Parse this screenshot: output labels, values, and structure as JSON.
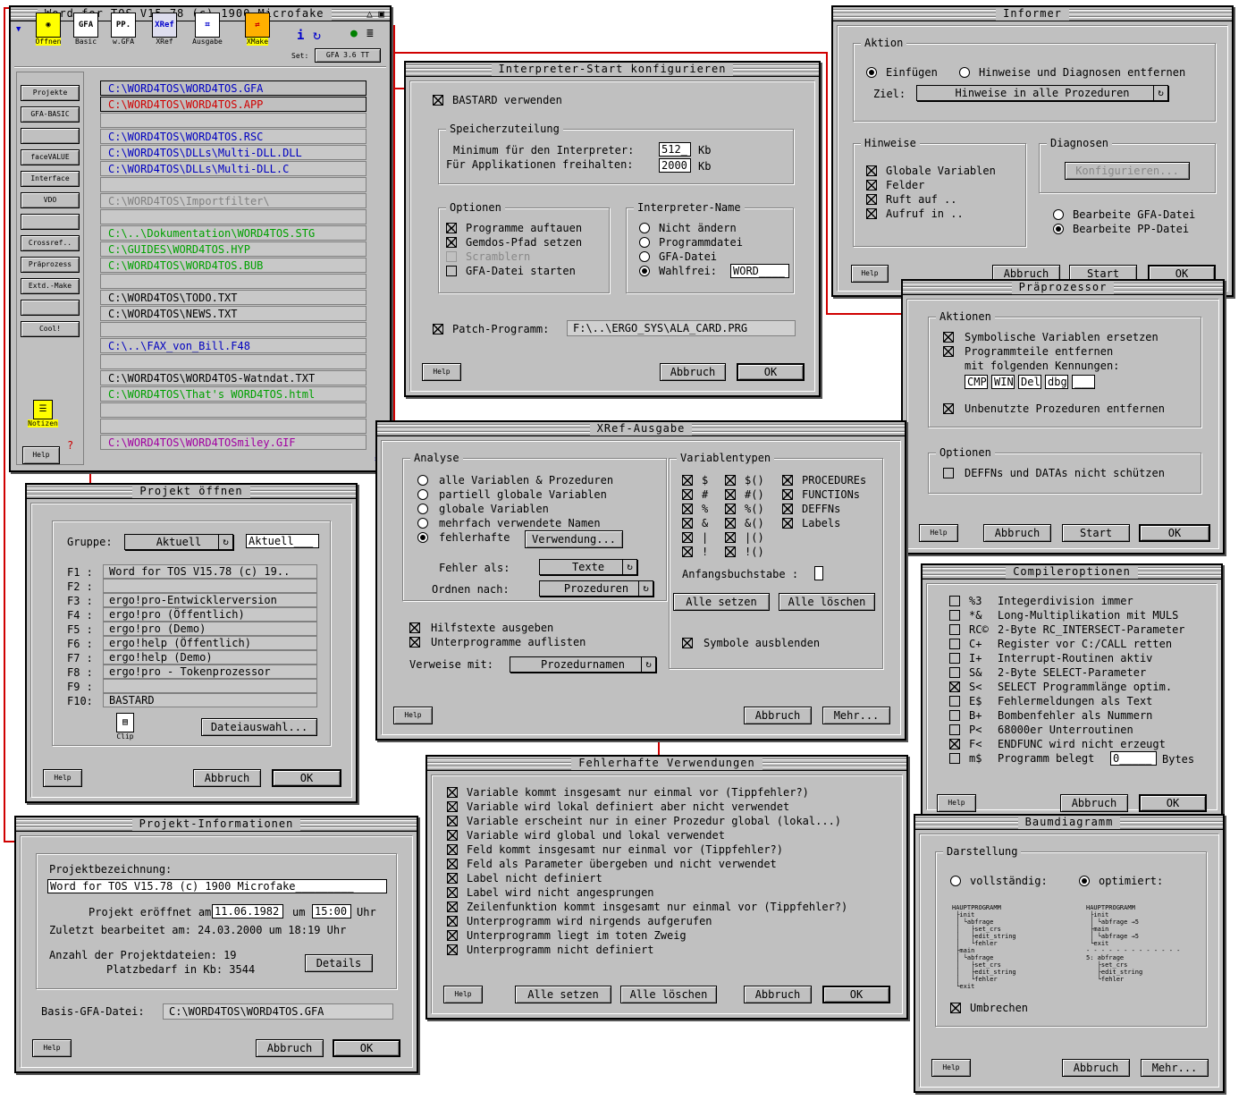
{
  "main": {
    "title": "Word for TOS V15.78 (c) 1900 Microfake",
    "tools": [
      "Öffnen",
      "Basic",
      "w.GFA",
      "XRef",
      "Ausgabe",
      "XMake"
    ],
    "tool_icons": [
      "GFA",
      "PP.",
      "XRef"
    ],
    "set_label": "Set:",
    "set_value": "GFA 3.6 TT",
    "side": [
      "Projekte",
      "GFA-BASIC",
      "",
      "faceVALUE",
      "Interface",
      "VDO",
      "",
      "Crossref..",
      "Präprozess",
      "Extd.-Make",
      "",
      "Cool!"
    ],
    "notizen": "Notizen",
    "help": "Help",
    "files": [
      {
        "t": "C:\\WORD4TOS\\WORD4TOS.GFA",
        "c": "#0000c0"
      },
      {
        "t": "C:\\WORD4TOS\\WORD4TOS.APP",
        "c": "#d00000"
      },
      {
        "t": "",
        "c": "#000"
      },
      {
        "t": "C:\\WORD4TOS\\WORD4TOS.RSC",
        "c": "#0000c0"
      },
      {
        "t": "C:\\WORD4TOS\\DLLs\\Multi-DLL.DLL",
        "c": "#0000c0"
      },
      {
        "t": "C:\\WORD4TOS\\DLLs\\Multi-DLL.C",
        "c": "#0000c0"
      },
      {
        "t": "",
        "c": "#000"
      },
      {
        "t": "C:\\WORD4TOS\\Importfilter\\",
        "c": "#808080"
      },
      {
        "t": "",
        "c": "#000"
      },
      {
        "t": "C:\\..\\Dokumentation\\WORD4TOS.STG",
        "c": "#00a000"
      },
      {
        "t": "C:\\GUIDES\\WORD4TOS.HYP",
        "c": "#00a000"
      },
      {
        "t": "C:\\WORD4TOS\\WORD4TOS.BUB",
        "c": "#00a000"
      },
      {
        "t": "",
        "c": "#000"
      },
      {
        "t": "C:\\WORD4TOS\\TODO.TXT",
        "c": "#000"
      },
      {
        "t": "C:\\WORD4TOS\\NEWS.TXT",
        "c": "#000"
      },
      {
        "t": "",
        "c": "#000"
      },
      {
        "t": "C:\\..\\FAX_von_Bill.F48",
        "c": "#0000c0"
      },
      {
        "t": "",
        "c": "#000"
      },
      {
        "t": "C:\\WORD4TOS\\WORD4TOS-Watndat.TXT",
        "c": "#000"
      },
      {
        "t": "C:\\WORD4TOS\\That's WORD4TOS.html",
        "c": "#00a000"
      },
      {
        "t": "",
        "c": "#000"
      },
      {
        "t": "",
        "c": "#000"
      },
      {
        "t": "C:\\WORD4TOS\\WORD4TOSmiley.GIF",
        "c": "#a000a0"
      }
    ]
  },
  "interp": {
    "title": "Interpreter-Start konfigurieren",
    "bastard": "BASTARD verwenden",
    "mem_group": "Speicherzuteilung",
    "min_label": "Minimum für den Interpreter:",
    "min_val": "512_",
    "free_label": "Für Applikationen freihalten:",
    "free_val": "2000",
    "kb": "Kb",
    "opt_group": "Optionen",
    "opts": [
      "Programme auftauen",
      "Gemdos-Pfad setzen",
      "Scramblern",
      "GFA-Datei starten"
    ],
    "name_group": "Interpreter-Name",
    "names": [
      "Nicht ändern",
      "Programmdatei",
      "GFA-Datei",
      "Wahlfrei:"
    ],
    "wahl_val": "WORD____",
    "patch_label": "Patch-Programm:",
    "patch_val": "F:\\..\\ERGO_SYS\\ALA_CARD.PRG",
    "help": "Help",
    "cancel": "Abbruch",
    "ok": "OK"
  },
  "informer": {
    "title": "Informer",
    "aktion": "Aktion",
    "r1": "Einfügen",
    "r2": "Hinweise und Diagnosen entfernen",
    "ziel": "Ziel:",
    "ziel_val": "Hinweise in alle Prozeduren",
    "hinweise": "Hinweise",
    "h": [
      "Globale Variablen",
      "Felder",
      "Ruft auf ..",
      "Aufruf in .."
    ],
    "diag": "Diagnosen",
    "konf": "Konfigurieren...",
    "b1": "Bearbeite GFA-Datei",
    "b2": "Bearbeite PP-Datei",
    "help": "Help",
    "cancel": "Abbruch",
    "start": "Start",
    "ok": "OK"
  },
  "prae": {
    "title": "Präprozessor",
    "aktionen": "Aktionen",
    "a1": "Symbolische Variablen ersetzen",
    "a2": "Programmteile entfernen",
    "a2b": "mit folgenden Kennungen:",
    "keys": [
      "CMP",
      "WIN",
      "Del",
      "dbg",
      "___"
    ],
    "a3": "Unbenutzte Prozeduren entfernen",
    "optionen": "Optionen",
    "o1": "DEFFNs und DATAs nicht schützen",
    "help": "Help",
    "cancel": "Abbruch",
    "start": "Start",
    "ok": "OK"
  },
  "projopen": {
    "title": "Projekt öffnen",
    "gruppe": "Gruppe:",
    "gruppe_val": "Aktuell",
    "gruppe_fld": "Aktuell___",
    "keys": [
      "F1 :",
      "F2 :",
      "F3 :",
      "F4 :",
      "F5 :",
      "F6 :",
      "F7 :",
      "F8 :",
      "F9 :",
      "F10:"
    ],
    "vals": [
      "Word for TOS V15.78 (c) 19..",
      "",
      "ergo!pro-Entwicklerversion",
      "ergo!pro (Öffentlich)",
      "ergo!pro (Demo)",
      "ergo!help (Öffentlich)",
      "ergo!help (Demo)",
      "ergo!pro - Tokenprozessor",
      "",
      "BASTARD"
    ],
    "clip": "Clip",
    "dateiauswahl": "Dateiauswahl...",
    "help": "Help",
    "cancel": "Abbruch",
    "ok": "OK"
  },
  "xref": {
    "title": "XRef-Ausgabe",
    "analyse": "Analyse",
    "radios": [
      "alle Variablen & Prozeduren",
      "partiell globale Variablen",
      "globale Variablen",
      "mehrfach verwendete Namen",
      "fehlerhafte"
    ],
    "verwendung": "Verwendung...",
    "fehler_als": "Fehler als:",
    "fehler_val": "Texte",
    "ordnen": "Ordnen nach:",
    "ordnen_val": "Prozeduren",
    "c1": "Hilfstexte ausgeben",
    "c2": "Unterprogramme auflisten",
    "verweise": "Verweise mit:",
    "verweise_val": "Prozedurnamen",
    "vartypen": "Variablentypen",
    "col1": [
      "$",
      "#",
      "%",
      "&",
      "|",
      "!"
    ],
    "col2": [
      "$()",
      "#()",
      "%()",
      "&()",
      "|()",
      "!()"
    ],
    "col3": [
      "PROCEDUREs",
      "FUNCTIONs",
      "DEFFNs",
      "Labels"
    ],
    "anfang": "Anfangsbuchstabe :",
    "alle_setzen": "Alle setzen",
    "alle_loeschen": "Alle löschen",
    "symbole": "Symbole ausblenden",
    "help": "Help",
    "cancel": "Abbruch",
    "mehr": "Mehr..."
  },
  "compiler": {
    "title": "Compileroptionen",
    "codes": [
      "%3",
      "*&",
      "RC©",
      "C+",
      "I+",
      "S&",
      "S<",
      "E$",
      "B+",
      "P<",
      "F<",
      "m$"
    ],
    "texts": [
      "Integerdivision immer",
      "Long-Multiplikation mit MULS",
      "2-Byte RC_INTERSECT-Parameter",
      "Register vor C:/CALL retten",
      "Interrupt-Routinen aktiv",
      "2-Byte SELECT-Parameter",
      "SELECT Programmlänge optim.",
      "Fehlermeldungen als Text",
      "Bombenfehler als Nummern",
      "68000er Unterroutinen",
      "ENDFUNC wird nicht erzeugt",
      "Programm belegt"
    ],
    "checked": [
      false,
      false,
      false,
      false,
      false,
      false,
      true,
      false,
      false,
      false,
      true,
      false
    ],
    "bytes_val": "0_____",
    "bytes": "Bytes",
    "help": "Help",
    "cancel": "Abbruch",
    "ok": "OK"
  },
  "projinfo": {
    "title": "Projekt-Informationen",
    "bez": "Projektbezeichnung:",
    "bez_val": "Word for TOS V15.78 (c) 1900 Microfake_________",
    "eroeffnet": "Projekt eröffnet am:",
    "date1": "11.06.1982",
    "um": "um",
    "time1": "15:00",
    "uhr": "Uhr",
    "zuletzt": "Zuletzt bearbeitet am: 24.03.2000 um 18:19 Uhr",
    "anzahl": "Anzahl der Projektdateien: 19",
    "platz": "Platzbedarf in Kb: 3544",
    "details": "Details",
    "basis": "Basis-GFA-Datei:",
    "basis_val": "C:\\WORD4TOS\\WORD4TOS.GFA",
    "help": "Help",
    "cancel": "Abbruch",
    "ok": "OK"
  },
  "fehler": {
    "title": "Fehlerhafte Verwendungen",
    "items": [
      "Variable kommt insgesamt nur einmal vor (Tippfehler?)",
      "Variable wird lokal definiert aber nicht verwendet",
      "Variable erscheint nur in einer Prozedur global (lokal...)",
      "Variable wird global und lokal verwendet",
      "Feld kommt insgesamt nur einmal vor (Tippfehler?)",
      "Feld als Parameter übergeben und nicht verwendet",
      "Label nicht definiert",
      "Label wird nicht angesprungen",
      "Zeilenfunktion kommt insgesamt nur einmal vor (Tippfehler?)",
      "Unterprogramm wird nirgends aufgerufen",
      "Unterprogramm liegt im toten Zweig",
      "Unterprogramm nicht definiert"
    ],
    "help": "Help",
    "alle_setzen": "Alle setzen",
    "alle_loeschen": "Alle löschen",
    "cancel": "Abbruch",
    "ok": "OK"
  },
  "baum": {
    "title": "Baumdiagramm",
    "darst": "Darstellung",
    "r1": "vollständig:",
    "r2": "optimiert:",
    "tree1": "HAUPTPROGRAMM\n ├init\n │ └abfrage\n │   ├set_crs\n │   ├edit_string\n │   └fehler\n ├main\n │ └abfrage\n │   ├set_crs\n │   ├edit_string\n │   └fehler\n └exit",
    "tree2": "HAUPTPROGRAMM\n ├init\n │ └abfrage →5\n ├main\n │ └abfrage →5\n └exit\n- - - - - - - - - - - - -\n5: abfrage\n   ├set_crs\n   ├edit_string\n   └fehler",
    "umbrechen": "Umbrechen",
    "help": "Help",
    "cancel": "Abbruch",
    "mehr": "Mehr..."
  }
}
